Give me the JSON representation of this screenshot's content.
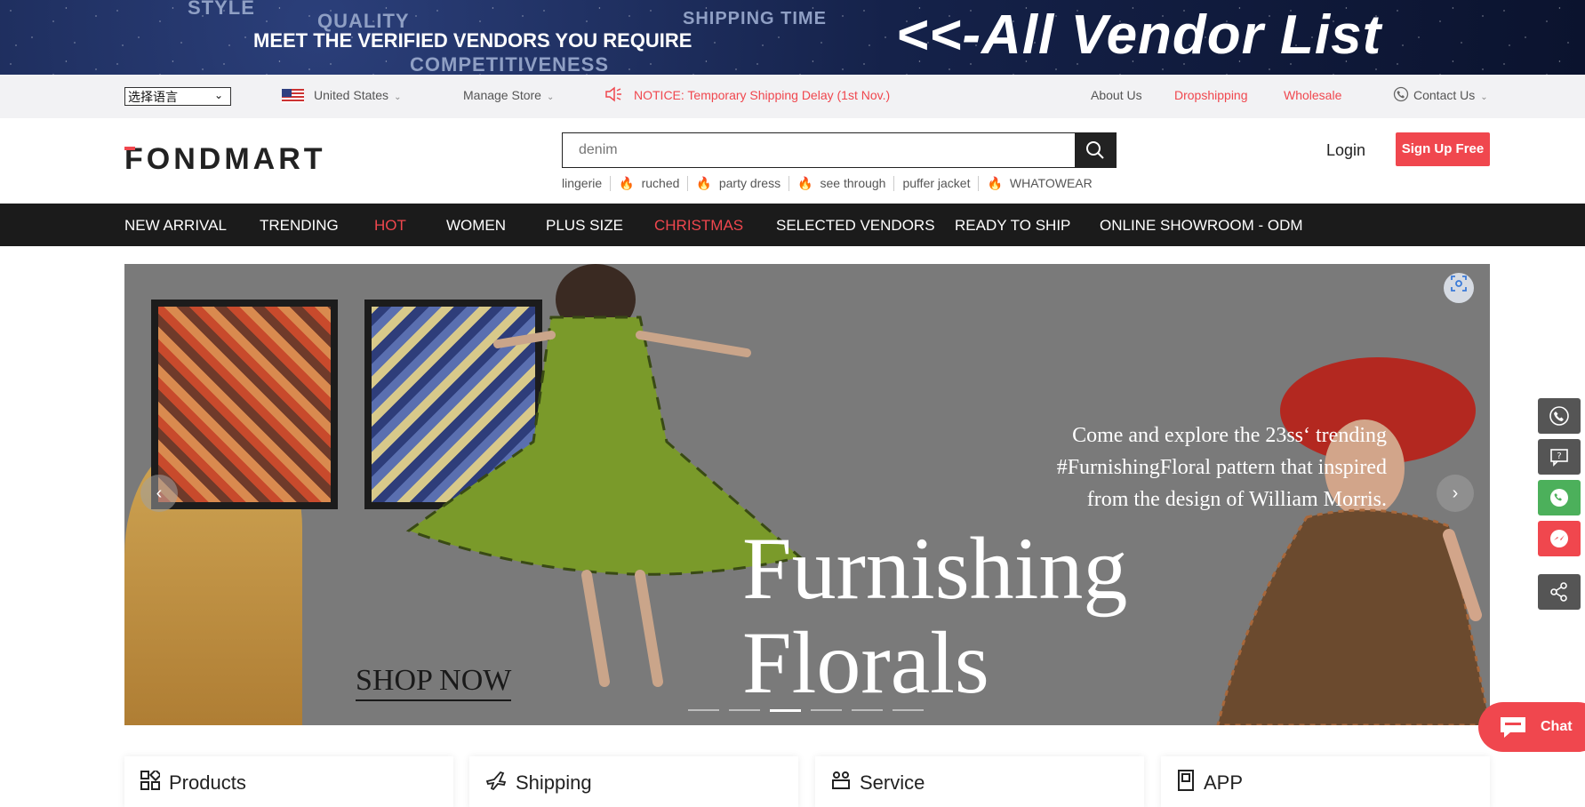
{
  "banner": {
    "watermarks": [
      "STYLE",
      "QUALITY",
      "SHIPPING TIME",
      "COMPETITIVENESS"
    ],
    "tagline": "MEET THE VERIFIED VENDORS YOU REQUIRE",
    "cta": "<<-All Vendor List"
  },
  "utility": {
    "language": "选择语言",
    "country": "United States",
    "manage_store": "Manage Store",
    "notice": "NOTICE: Temporary Shipping Delay (1st Nov.)",
    "about": "About Us",
    "dropshipping": "Dropshipping",
    "wholesale": "Wholesale",
    "contact": "Contact Us"
  },
  "header": {
    "logo": "FONDMART",
    "search_placeholder": "denim",
    "hot_terms": [
      {
        "label": "lingerie",
        "hot": false
      },
      {
        "label": "ruched",
        "hot": true
      },
      {
        "label": "party dress",
        "hot": true
      },
      {
        "label": "see through",
        "hot": true
      },
      {
        "label": "puffer jacket",
        "hot": false
      },
      {
        "label": "WHATOWEAR",
        "hot": true
      }
    ],
    "login": "Login",
    "signup": "Sign Up Free"
  },
  "nav": [
    {
      "label": "NEW ARRIVAL",
      "highlight": false
    },
    {
      "label": "TRENDING",
      "highlight": false
    },
    {
      "label": "HOT",
      "highlight": true
    },
    {
      "label": "WOMEN",
      "highlight": false
    },
    {
      "label": "PLUS SIZE",
      "highlight": false
    },
    {
      "label": "CHRISTMAS",
      "highlight": true
    },
    {
      "label": "SELECTED VENDORS",
      "highlight": false
    },
    {
      "label": "READY TO SHIP",
      "highlight": false
    },
    {
      "label": "ONLINE SHOWROOM - ODM",
      "highlight": false
    }
  ],
  "hero": {
    "copy": [
      "Come and explore the 23ss‘ trending",
      "#FurnishingFloral pattern that inspired",
      "from the design of William Morris."
    ],
    "title_line1": "Furnishing",
    "title_line2": "Florals",
    "shop_now": "SHOP NOW",
    "slide_count": 6,
    "active_slide": 3
  },
  "float": {
    "chat": "Chat"
  },
  "cards": [
    {
      "label": "Products",
      "icon": "grid-icon"
    },
    {
      "label": "Shipping",
      "icon": "plane-icon"
    },
    {
      "label": "Service",
      "icon": "service-icon"
    },
    {
      "label": "APP",
      "icon": "phone-app-icon"
    }
  ],
  "colors": {
    "accent": "#f0474e",
    "nav_bg": "#1b1b1b",
    "utility_bg": "#f2f2f4"
  }
}
